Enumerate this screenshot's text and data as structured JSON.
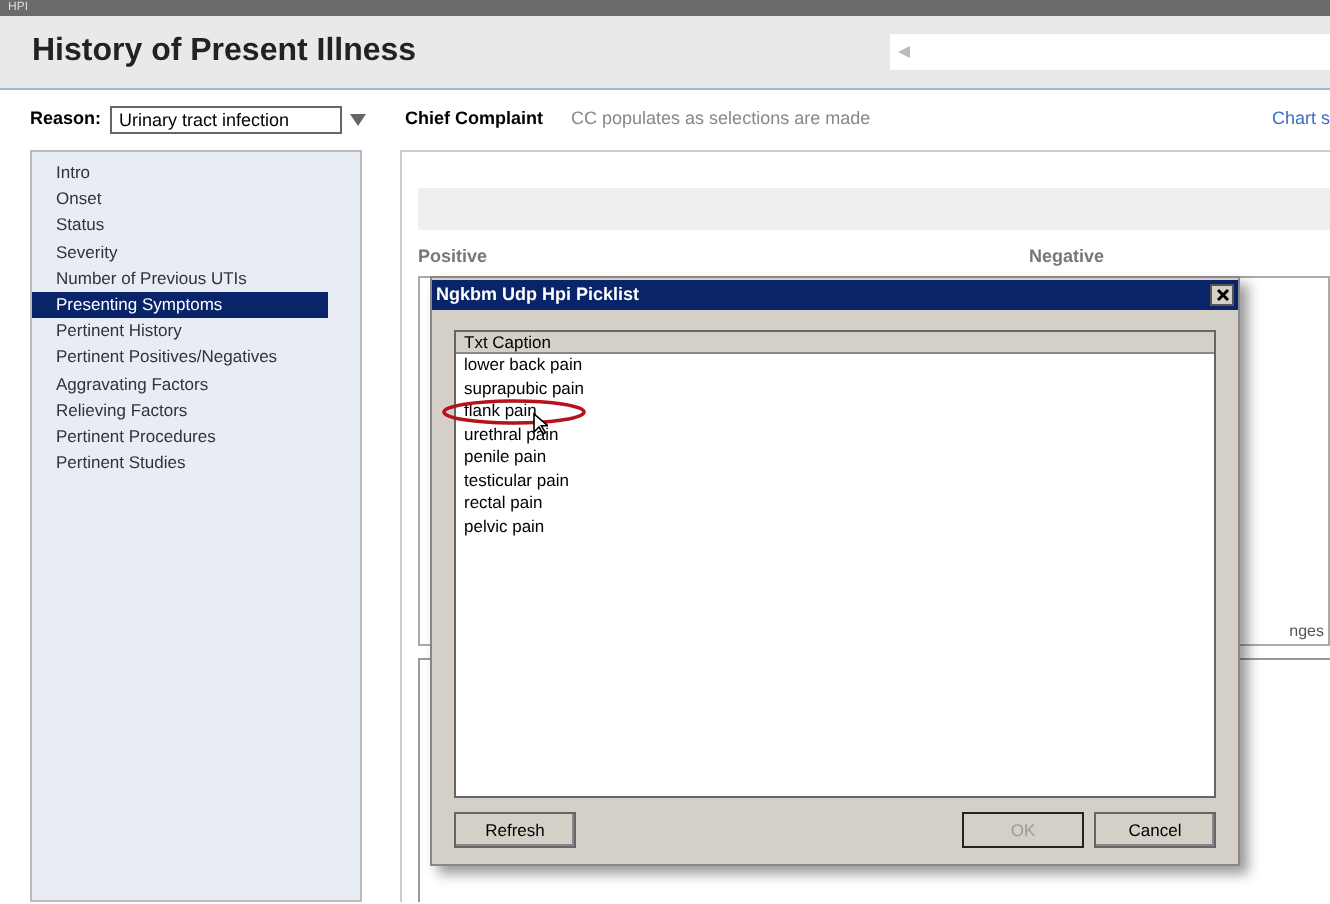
{
  "top_bar": {
    "label": "HPI"
  },
  "header": {
    "title": "History of Present Illness"
  },
  "reason": {
    "label": "Reason:",
    "value": "Urinary tract infection"
  },
  "chief_complaint": {
    "label": "Chief Complaint",
    "hint": "CC populates as selections are made"
  },
  "chart_link": "Chart s",
  "sidebar": {
    "items": [
      {
        "label": "Intro",
        "selected": false
      },
      {
        "label": "Onset",
        "selected": false
      },
      {
        "label": "Status",
        "selected": false
      },
      {
        "label": "Severity",
        "selected": false
      },
      {
        "label": "Number of Previous UTIs",
        "selected": false
      },
      {
        "label": "Presenting Symptoms",
        "selected": true
      },
      {
        "label": "Pertinent History",
        "selected": false
      },
      {
        "label": "Pertinent Positives/Negatives",
        "selected": false
      },
      {
        "label": "Aggravating Factors",
        "selected": false
      },
      {
        "label": "Relieving Factors",
        "selected": false
      },
      {
        "label": "Pertinent Procedures",
        "selected": false
      },
      {
        "label": "Pertinent Studies",
        "selected": false
      }
    ]
  },
  "columns": {
    "positive": "Positive",
    "negative": "Negative"
  },
  "behind_text": "nges",
  "dialog": {
    "title": "Ngkbm Udp Hpi Picklist",
    "column": "Txt Caption",
    "items": [
      {
        "label": "lower back pain",
        "circled": false
      },
      {
        "label": "suprapubic pain",
        "circled": false
      },
      {
        "label": "flank pain",
        "circled": true
      },
      {
        "label": "urethral pain",
        "circled": false
      },
      {
        "label": "penile pain",
        "circled": false
      },
      {
        "label": "testicular pain",
        "circled": false
      },
      {
        "label": "rectal pain",
        "circled": false
      },
      {
        "label": "pelvic pain",
        "circled": false
      }
    ],
    "buttons": [
      {
        "label": "Refresh",
        "disabled": false
      },
      {
        "label": "OK",
        "disabled": true
      },
      {
        "label": "Cancel",
        "disabled": false
      }
    ]
  }
}
